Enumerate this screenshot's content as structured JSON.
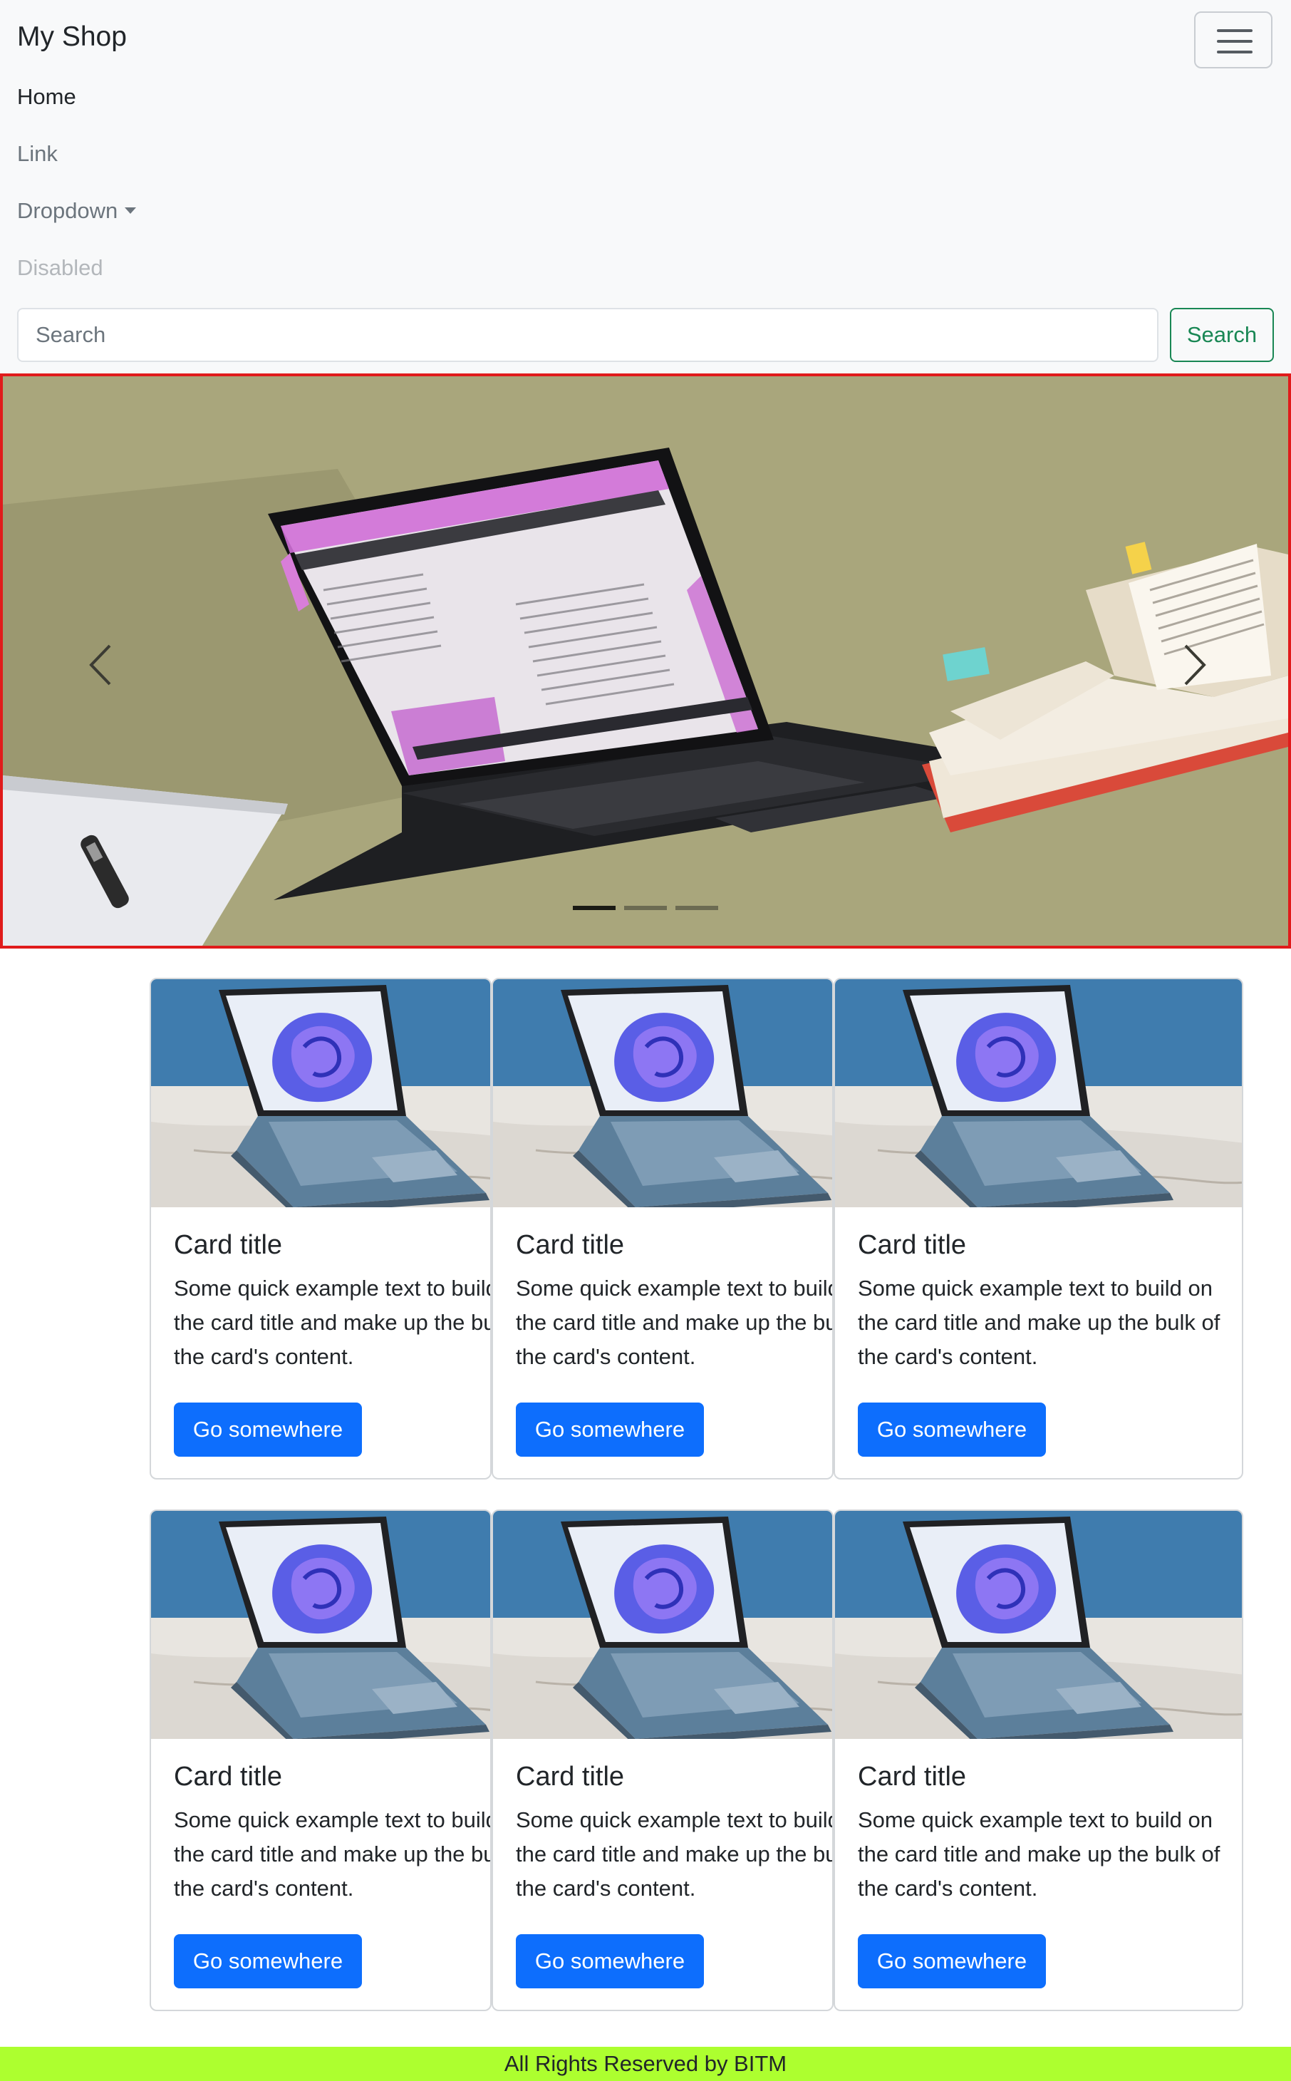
{
  "navbar": {
    "brand": "My Shop",
    "toggler_icon": "hamburger-icon",
    "links": [
      {
        "label": "Home",
        "state": "active"
      },
      {
        "label": "Link",
        "state": "normal"
      },
      {
        "label": "Dropdown",
        "state": "dropdown"
      },
      {
        "label": "Disabled",
        "state": "disabled"
      }
    ],
    "search": {
      "placeholder": "Search",
      "value": "",
      "button_label": "Search"
    }
  },
  "carousel": {
    "prev_icon": "chevron-left-icon",
    "next_icon": "chevron-right-icon",
    "indicator_count": 3,
    "active_indicator": 0,
    "border_color": "#e01b1b"
  },
  "cards": [
    {
      "title": "Card title",
      "text": "Some quick example text to build on the card title and make up the bulk of the card's content.",
      "button": "Go somewhere"
    },
    {
      "title": "Card title",
      "text": "Some quick example text to build on the card title and make up the bulk of the card's content.",
      "button": "Go somewhere"
    },
    {
      "title": "Card title",
      "text": "Some quick example text to build on the card title and make up the bulk of the card's content.",
      "button": "Go somewhere"
    },
    {
      "title": "Card title",
      "text": "Some quick example text to build on the card title and make up the bulk of the card's content.",
      "button": "Go somewhere"
    },
    {
      "title": "Card title",
      "text": "Some quick example text to build on the card title and make up the bulk of the card's content.",
      "button": "Go somewhere"
    },
    {
      "title": "Card title",
      "text": "Some quick example text to build on the card title and make up the bulk of the card's content.",
      "button": "Go somewhere"
    }
  ],
  "colors": {
    "primary": "#0d6efd",
    "success": "#198754",
    "footer_bg": "#adff2f",
    "navbar_bg": "#f8f9fa"
  },
  "footer": {
    "text": "All Rights Reserved by BITM"
  }
}
